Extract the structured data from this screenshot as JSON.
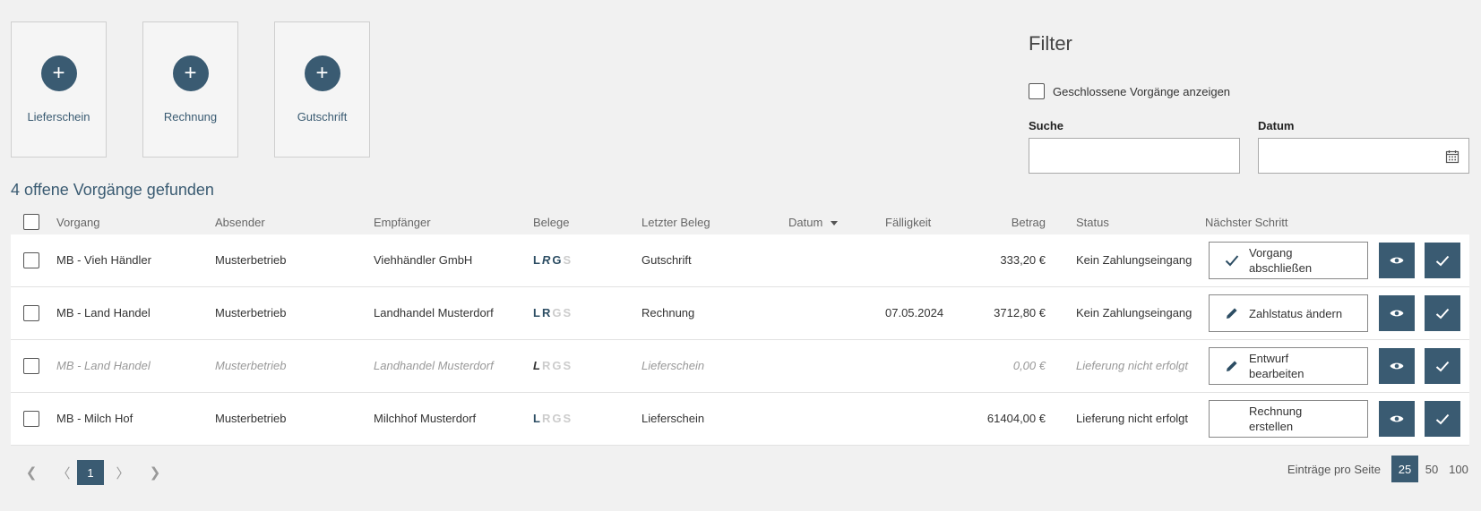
{
  "tiles": [
    {
      "label": "Lieferschein",
      "icon": "plus-icon"
    },
    {
      "label": "Rechnung",
      "icon": "plus-icon"
    },
    {
      "label": "Gutschrift",
      "icon": "plus-icon"
    }
  ],
  "filter": {
    "title": "Filter",
    "show_closed_label": "Geschlossene Vorgänge anzeigen",
    "show_closed_checked": false,
    "search_label": "Suche",
    "search_value": "",
    "date_label": "Datum",
    "date_value": "",
    "date_icon": "calendar-icon"
  },
  "found_text": "4 offene Vorgänge gefunden",
  "table": {
    "headers": {
      "vorgang": "Vorgang",
      "absender": "Absender",
      "empfaenger": "Empfänger",
      "belege": "Belege",
      "letzter_beleg": "Letzter Beleg",
      "datum": "Datum",
      "faelligkeit": "Fälligkeit",
      "betrag": "Betrag",
      "status": "Status",
      "naechster_schritt": "Nächster Schritt"
    },
    "sort_column": "Datum",
    "rows": [
      {
        "vorgang": "MB - Vieh Händler",
        "absender": "Musterbetrieb",
        "empfaenger": "Viehhändler GmbH",
        "letzter_beleg": "Gutschrift",
        "datum": "",
        "faelligkeit": "",
        "betrag": "333,20 €",
        "status": "Kein Zahlungseingang",
        "next_label": "Vorgang abschließen",
        "next_icon": "check-icon",
        "draft": false
      },
      {
        "vorgang": "MB - Land Handel",
        "absender": "Musterbetrieb",
        "empfaenger": "Landhandel Musterdorf",
        "letzter_beleg": "Rechnung",
        "datum": "",
        "faelligkeit": "07.05.2024",
        "betrag": "3712,80 €",
        "status": "Kein Zahlungseingang",
        "next_label": "Zahlstatus ändern",
        "next_icon": "pencil-icon",
        "draft": false
      },
      {
        "vorgang": "MB - Land Handel",
        "absender": "Musterbetrieb",
        "empfaenger": "Landhandel Musterdorf",
        "letzter_beleg": "Lieferschein",
        "datum": "",
        "faelligkeit": "",
        "betrag": "0,00 €",
        "status": "Lieferung nicht erfolgt",
        "next_label": "Entwurf bearbeiten",
        "next_icon": "pencil-icon",
        "draft": true
      },
      {
        "vorgang": "MB - Milch Hof",
        "absender": "Musterbetrieb",
        "empfaenger": "Milchhof Musterdorf",
        "letzter_beleg": "Lieferschein",
        "datum": "",
        "faelligkeit": "",
        "betrag": "61404,00 €",
        "status": "Lieferung nicht erfolgt",
        "next_label": "Rechnung erstellen",
        "next_icon": "",
        "draft": false
      }
    ],
    "belege_letters": [
      "L",
      "R",
      "G",
      "S"
    ]
  },
  "pagination": {
    "first": "❮",
    "prev": "〈",
    "current": "1",
    "next": "〉",
    "last": "❯",
    "per_page_label": "Einträge pro Seite",
    "per_page_options": [
      "25",
      "50",
      "100"
    ],
    "per_page_selected": "25"
  },
  "colors": {
    "accent": "#3a5b72",
    "background": "#f1f1f1"
  }
}
